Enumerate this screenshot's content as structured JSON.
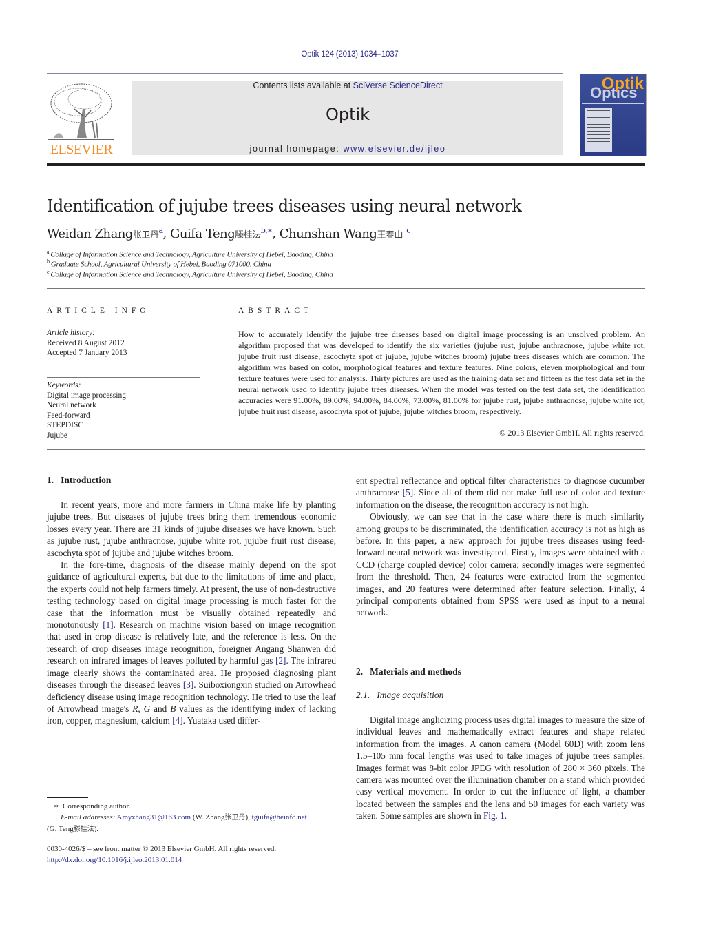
{
  "header": {
    "citation": "Optik 124 (2013) 1034–1037",
    "contents_prefix": "Contents lists available at ",
    "contents_link": "SciVerse ScienceDirect",
    "journal_name": "Optik",
    "homepage_prefix": "journal homepage: ",
    "homepage_link": "www.elsevier.de/ijleo",
    "publisher_logo": "ELSEVIER",
    "cover": {
      "title_top": "Optik",
      "title_bottom": "Optics"
    }
  },
  "article": {
    "title": "Identification of jujube trees diseases using neural network",
    "authors": [
      {
        "name": "Weidan Zhang",
        "cjk": "张卫丹",
        "sup": "a"
      },
      {
        "name": "Guifa Teng",
        "cjk": "滕桂法",
        "sup": "b,∗"
      },
      {
        "name": "Chunshan Wang",
        "cjk": "王春山",
        "sup": "c"
      }
    ],
    "affiliations": [
      {
        "sup": "a",
        "text": "Collage of Information Science and Technology, Agriculture University of Hebei, Baoding, China"
      },
      {
        "sup": "b",
        "text": "Graduate School, Agricultural University of Hebei, Baoding 071000, China"
      },
      {
        "sup": "c",
        "text": "Collage of Information Science and Technology, Agriculture University of Hebei, Baoding, China"
      }
    ]
  },
  "article_info": {
    "heading": "ARTICLE INFO",
    "history_label": "Article history:",
    "received": "Received 8 August 2012",
    "accepted": "Accepted 7 January 2013",
    "keywords_label": "Keywords:",
    "keywords": [
      "Digital image processing",
      "Neural network",
      "Feed-forward",
      "STEPDISC",
      "Jujube"
    ]
  },
  "abstract": {
    "heading": "ABSTRACT",
    "text": "How to accurately identify the jujube tree diseases based on digital image processing is an unsolved problem. An algorithm proposed that was developed to identify the six varieties (jujube rust, jujube anthracnose, jujube white rot, jujube fruit rust disease, ascochyta spot of jujube, jujube witches broom) jujube trees diseases which are common. The algorithm was based on color, morphological features and texture features. Nine colors, eleven morphological and four texture features were used for analysis. Thirty pictures are used as the training data set and fifteen as the test data set in the neural network used to identify jujube trees diseases. When the model was tested on the test data set, the identification accuracies were 91.00%, 89.00%, 94.00%, 84.00%, 73.00%, 81.00% for jujube rust, jujube anthracnose, jujube white rot, jujube fruit rust disease, ascochyta spot of jujube, jujube witches broom, respectively.",
    "copyright": "© 2013 Elsevier GmbH. All rights reserved."
  },
  "sections": {
    "s1": {
      "num": "1.",
      "title": "Introduction"
    },
    "s2": {
      "num": "2.",
      "title": "Materials and methods"
    },
    "s21": {
      "num": "2.1.",
      "title": "Image acquisition"
    }
  },
  "body": {
    "intro_p1": "In recent years, more and more farmers in China make life by planting jujube trees. But diseases of jujube trees bring them tremendous economic losses every year. There are 31 kinds of jujube diseases we have known. Such as jujube rust, jujube anthracnose, jujube white rot, jujube fruit rust disease, ascochyta spot of jujube and jujube witches broom.",
    "intro_p2_a": "In the fore-time, diagnosis of the disease mainly depend on the spot guidance of agricultural experts, but due to the limitations of time and place, the experts could not help farmers timely. At present, the use of non-destructive testing technology based on digital image processing is much faster for the case that the information must be visually obtained repeatedly and monotonously ",
    "ref1": "[1]",
    "intro_p2_b": ". Research on machine vision based on image recognition that used in crop disease is relatively late, and the reference is less. On the research of crop diseases image recognition, foreigner Angang Shanwen did research on infrared images of leaves polluted by harmful gas ",
    "ref2": "[2]",
    "intro_p2_c": ". The infrared image clearly shows the contaminated area. He proposed diagnosing plant diseases through the diseased leaves ",
    "ref3": "[3]",
    "intro_p2_d": ". Suiboxiongxin studied on Arrowhead deficiency disease using image recognition technology. He tried to use the leaf of Arrowhead image's ",
    "r": "R",
    "comma": ", ",
    "g": "G",
    "and": " and ",
    "b": "B",
    "intro_p2_e": " values as the identifying index of lacking iron, copper, magnesium, calcium ",
    "ref4": "[4]",
    "intro_p2_f": ". Yuataka used differ-",
    "right_p1_a": "ent spectral reflectance and optical filter characteristics to diagnose cucumber anthracnose ",
    "ref5": "[5]",
    "right_p1_b": ". Since all of them did not make full use of color and texture information on the disease, the recognition accuracy is not high.",
    "right_p2": "Obviously, we can see that in the case where there is much similarity among groups to be discriminated, the identification accuracy is not as high as before. In this paper, a new approach for jujube trees diseases using feed-forward neural network was investigated. Firstly, images were obtained with a CCD (charge coupled device) color camera; secondly images were segmented from the threshold. Then, 24 features were extracted from the segmented images, and 20 features were determined after feature selection. Finally, 4 principal components obtained from SPSS were used as input to a neural network.",
    "acq_p1_a": "Digital image anglicizing process uses digital images to measure the size of individual leaves and mathematically extract features and shape related information from the images. A canon camera (Model 60D) with zoom lens 1.5–105 mm focal lengths was used to take images of jujube trees samples. Images format was 8-bit color JPEG with resolution of 280 × 360 pixels. The camera was mounted over the illumination chamber on a stand which provided easy vertical movement. In order to cut the influence of light, a chamber located between the samples and the lens and 50 images for each variety was taken. Some samples are shown in ",
    "fig1": "Fig. 1",
    "acq_p1_b": "."
  },
  "footnote": {
    "star": "∗",
    "corresponding": "Corresponding author.",
    "email_label": "E-mail addresses:",
    "email1": "Amyzhang31@163.com",
    "email1_owner": " (W. Zhang",
    "email1_cjk": "张卫丹",
    "sep": "), ",
    "email2": "tguifa@heinfo.net",
    "email2_owner": "(G. Teng",
    "email2_cjk": "滕桂法",
    "close": ")."
  },
  "front_matter": {
    "issn": "0030-4026/$ – see front matter © 2013 Elsevier GmbH. All rights reserved.",
    "doi": "http://dx.doi.org/10.1016/j.ijleo.2013.01.014"
  }
}
